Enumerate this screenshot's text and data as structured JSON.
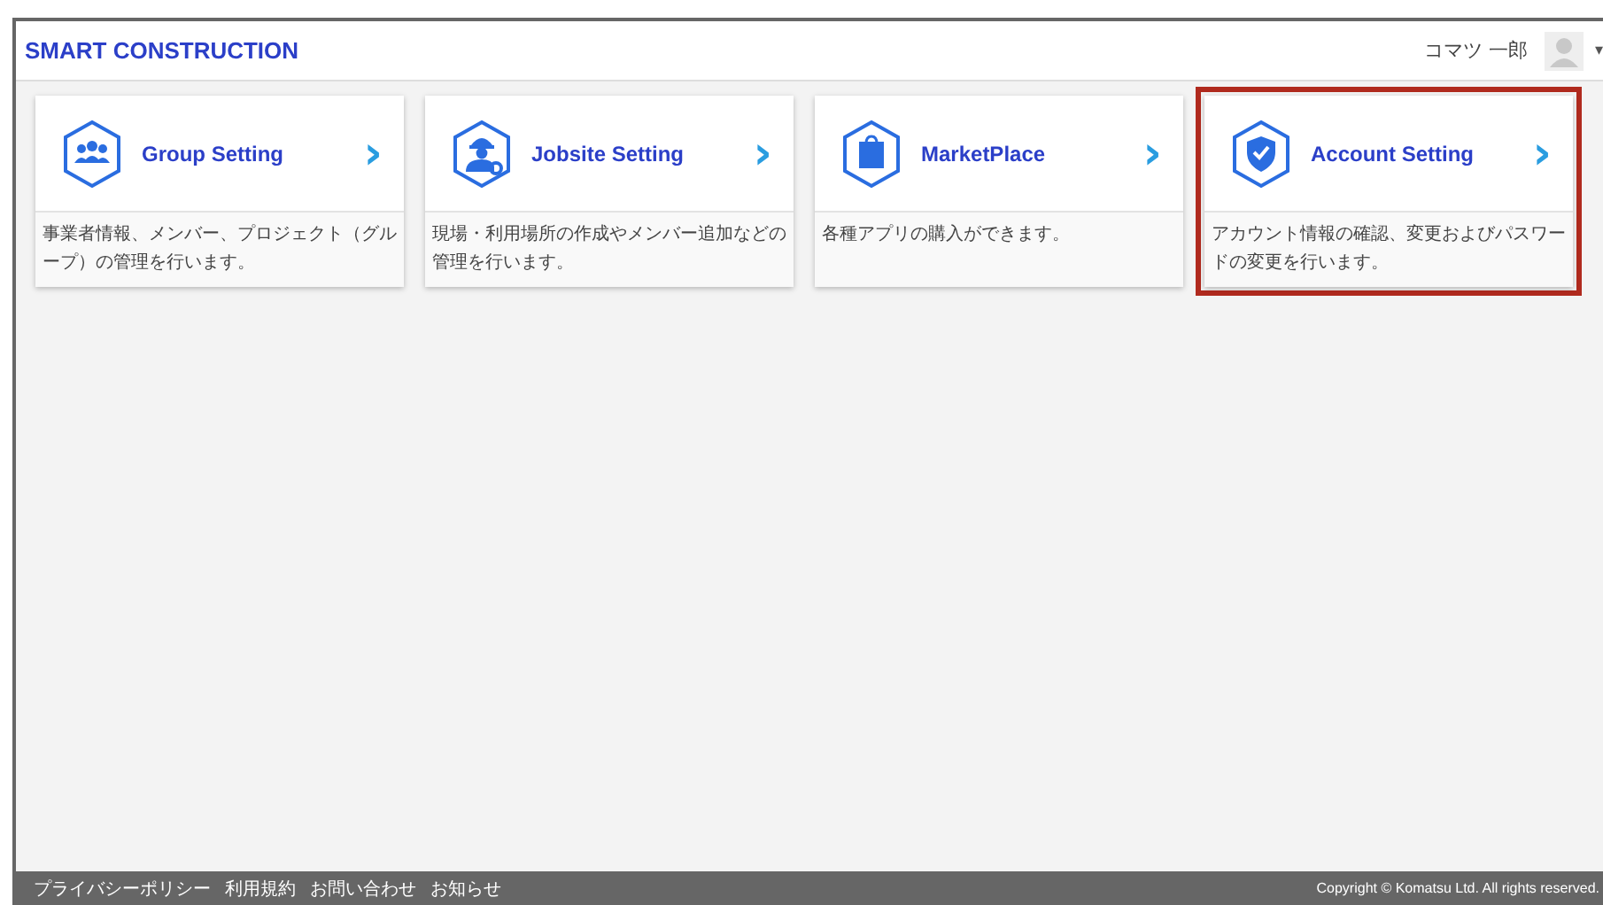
{
  "header": {
    "logo": "SMART CONSTRUCTION",
    "user_name": "コマツ 一郎",
    "menu_caret": "▾"
  },
  "cards": [
    {
      "kind": "group",
      "title": "Group Setting",
      "arrow": "›",
      "description": "事業者情報、メンバー、プロジェクト（グループ）の管理を行います。",
      "highlighted": false
    },
    {
      "kind": "worker",
      "title": "Jobsite Setting",
      "arrow": "›",
      "description": "現場・利用場所の作成やメンバー追加などの管理を行います。",
      "highlighted": false
    },
    {
      "kind": "bag",
      "title": "MarketPlace",
      "arrow": "›",
      "description": "各種アプリの購入ができます。",
      "highlighted": false
    },
    {
      "kind": "shield",
      "title": "Account Setting",
      "arrow": "›",
      "description": "アカウント情報の確認、変更およびパスワードの変更を行います。",
      "highlighted": true
    }
  ],
  "footer": {
    "links": [
      "プライバシーポリシー",
      "利用規約",
      "お問い合わせ",
      "お知らせ"
    ],
    "copyright": "Copyright © Komatsu Ltd. All rights reserved."
  }
}
